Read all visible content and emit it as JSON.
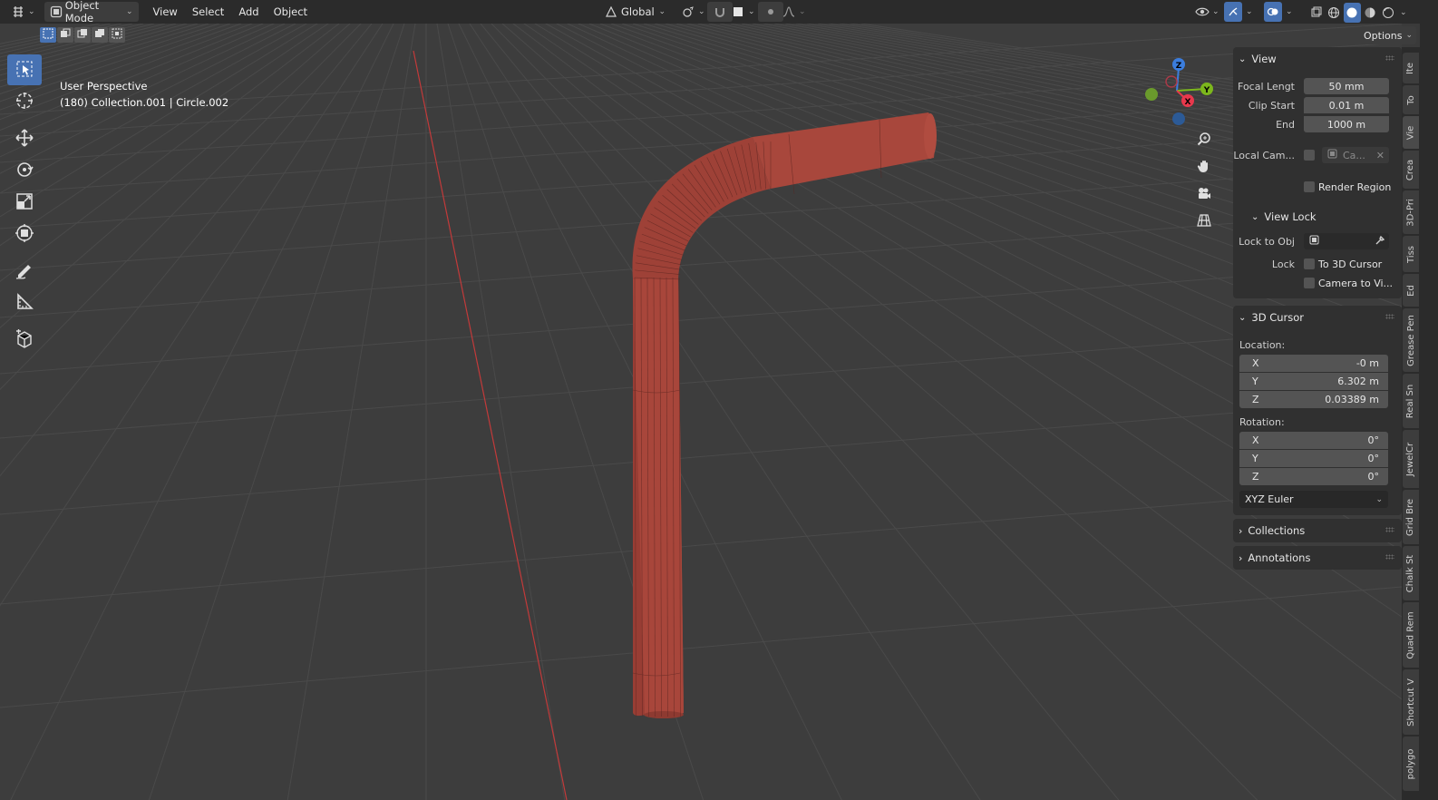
{
  "header": {
    "editor_type_icon": "grid-editor-icon",
    "mode": "Object Mode",
    "menus": [
      "View",
      "Select",
      "Add",
      "Object"
    ],
    "transform_orientation": "Global",
    "options_label": "Options"
  },
  "viewport": {
    "perspective": "User Perspective",
    "object_info": "(180) Collection.001 | Circle.002",
    "gizmo": {
      "x_label": "X",
      "y_label": "Y",
      "z_label": "Z"
    }
  },
  "toolbar": {
    "tools": [
      "select-box",
      "cursor",
      "move",
      "rotate",
      "scale",
      "transform",
      "annotate",
      "measure",
      "add-cube"
    ],
    "active": "select-box"
  },
  "npanel": {
    "view": {
      "title": "View",
      "focal_label": "Focal Lengt",
      "focal_value": "50 mm",
      "clip_start_label": "Clip Start",
      "clip_start_value": "0.01 m",
      "clip_end_label": "End",
      "clip_end_value": "1000 m",
      "local_cam_label": "Local Cam...",
      "local_cam_value": "Ca...",
      "render_region_label": "Render Region"
    },
    "view_lock": {
      "title": "View Lock",
      "lock_to_obj_label": "Lock to Obj",
      "lock_label": "Lock",
      "to_cursor_label": "To 3D Cursor",
      "camera_to_view_label": "Camera to Vi..."
    },
    "cursor": {
      "title": "3D Cursor",
      "location_label": "Location:",
      "loc": [
        {
          "axis": "X",
          "value": "-0 m"
        },
        {
          "axis": "Y",
          "value": "6.302 m"
        },
        {
          "axis": "Z",
          "value": "0.03389 m"
        }
      ],
      "rotation_label": "Rotation:",
      "rot": [
        {
          "axis": "X",
          "value": "0°"
        },
        {
          "axis": "Y",
          "value": "0°"
        },
        {
          "axis": "Z",
          "value": "0°"
        }
      ],
      "rotation_mode": "XYZ Euler"
    },
    "collections_title": "Collections",
    "annotations_title": "Annotations"
  },
  "tabs": [
    "Ite",
    "To",
    "Vie",
    "Crea",
    "3D-Pri",
    "Tiss",
    "Ed",
    "Grease Pen",
    "Real Sn",
    "JewelCr",
    "Grid Bre",
    "Chalk St",
    "Quad Rem",
    "Shortcut V",
    "polygo"
  ],
  "colors": {
    "accent": "#4772b3",
    "header_bg": "#2b2b2b",
    "viewport_bg": "#3d3d3d",
    "panel_bg": "#303030",
    "field_bg": "#545454",
    "mesh": "#a5443a",
    "x_axis_line": "#c23a3a"
  }
}
